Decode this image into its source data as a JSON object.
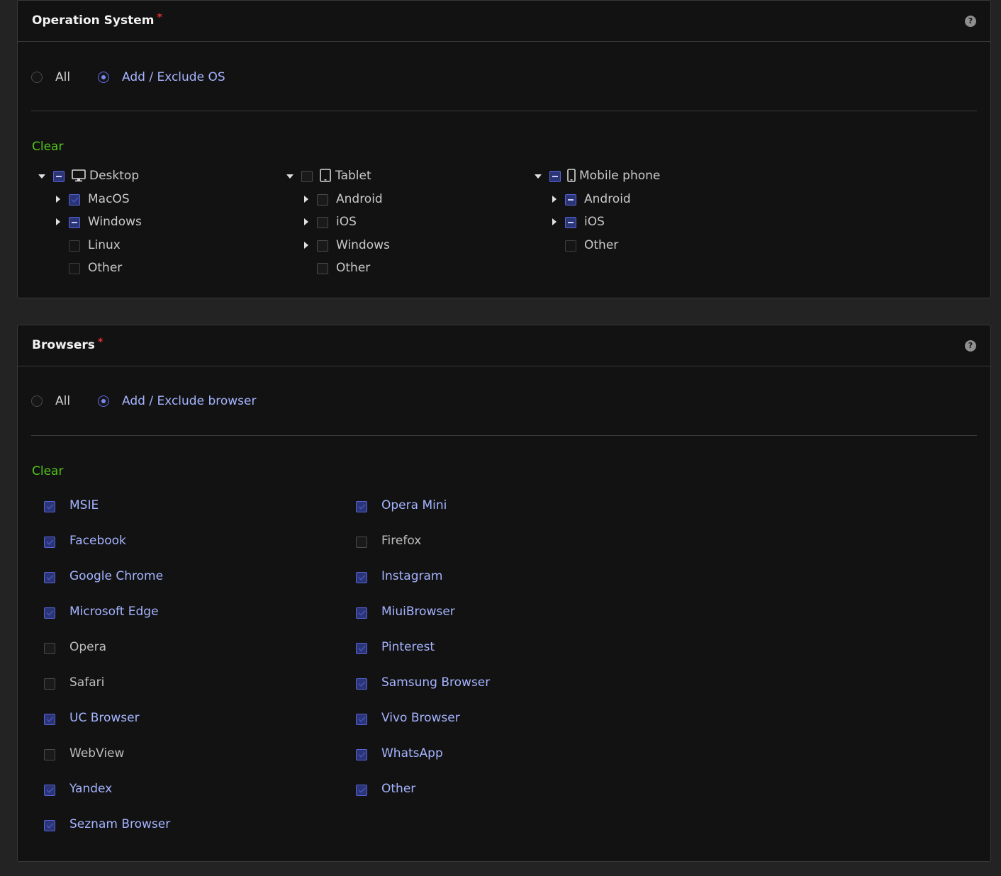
{
  "os_panel": {
    "title": "Operation System",
    "required_mark": "*",
    "help_icon": "?",
    "radio_all": "All",
    "radio_custom": "Add / Exclude OS",
    "selected": "custom",
    "clear_label": "Clear",
    "columns": [
      {
        "label": "Desktop",
        "icon": "desktop-icon",
        "state": "partial",
        "children": [
          {
            "label": "MacOS",
            "state": "checked",
            "expandable": true
          },
          {
            "label": "Windows",
            "state": "partial",
            "expandable": true
          },
          {
            "label": "Linux",
            "state": "unchecked",
            "expandable": false
          },
          {
            "label": "Other",
            "state": "unchecked",
            "expandable": false
          }
        ]
      },
      {
        "label": "Tablet",
        "icon": "tablet-icon",
        "state": "unchecked",
        "children": [
          {
            "label": "Android",
            "state": "unchecked",
            "expandable": true
          },
          {
            "label": "iOS",
            "state": "unchecked",
            "expandable": true
          },
          {
            "label": "Windows",
            "state": "unchecked",
            "expandable": true
          },
          {
            "label": "Other",
            "state": "unchecked",
            "expandable": false
          }
        ]
      },
      {
        "label": "Mobile phone",
        "icon": "mobile-phone-icon",
        "state": "partial",
        "children": [
          {
            "label": "Android",
            "state": "partial",
            "expandable": true
          },
          {
            "label": "iOS",
            "state": "partial",
            "expandable": true
          },
          {
            "label": "Other",
            "state": "unchecked",
            "expandable": false
          }
        ]
      }
    ]
  },
  "browsers_panel": {
    "title": "Browsers",
    "required_mark": "*",
    "help_icon": "?",
    "radio_all": "All",
    "radio_custom": "Add / Exclude browser",
    "selected": "custom",
    "clear_label": "Clear",
    "left_column": [
      {
        "label": "MSIE",
        "checked": true
      },
      {
        "label": "Facebook",
        "checked": true
      },
      {
        "label": "Google Chrome",
        "checked": true
      },
      {
        "label": "Microsoft Edge",
        "checked": true
      },
      {
        "label": "Opera",
        "checked": false
      },
      {
        "label": "Safari",
        "checked": false
      },
      {
        "label": "UC Browser",
        "checked": true
      },
      {
        "label": "WebView",
        "checked": false
      },
      {
        "label": "Yandex",
        "checked": true
      },
      {
        "label": "Seznam Browser",
        "checked": true
      }
    ],
    "right_column": [
      {
        "label": "Opera Mini",
        "checked": true
      },
      {
        "label": "Firefox",
        "checked": false
      },
      {
        "label": "Instagram",
        "checked": true
      },
      {
        "label": "MiuiBrowser",
        "checked": true
      },
      {
        "label": "Pinterest",
        "checked": true
      },
      {
        "label": "Samsung Browser",
        "checked": true
      },
      {
        "label": "Vivo Browser",
        "checked": true
      },
      {
        "label": "WhatsApp",
        "checked": true
      },
      {
        "label": "Other",
        "checked": true
      }
    ]
  },
  "colors": {
    "accent": "#7c89f2",
    "checked_fill": "#2b3575",
    "clear_link": "#52c41a",
    "required": "#e03131",
    "panel_bg": "#121212",
    "page_bg": "#232323"
  }
}
